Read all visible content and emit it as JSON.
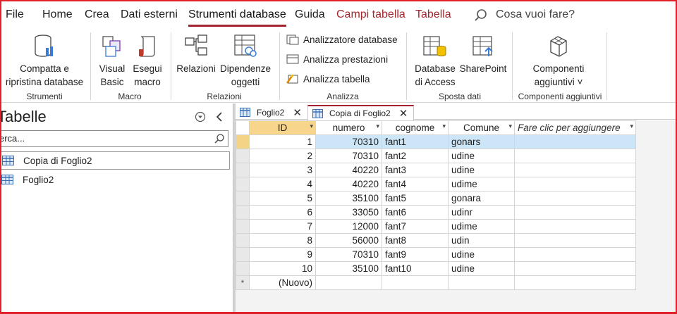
{
  "menu": {
    "items": [
      "File",
      "Home",
      "Crea",
      "Dati esterni",
      "Strumenti database",
      "Guida",
      "Campi tabella",
      "Tabella"
    ],
    "search_placeholder": "Cosa vuoi fare?"
  },
  "ribbon": {
    "compatta_line1": "Compatta e",
    "compatta_line2": "ripristina database",
    "group_strumenti": "Strumenti",
    "visual_line1": "Visual",
    "visual_line2": "Basic",
    "esegui_line1": "Esegui",
    "esegui_line2": "macro",
    "group_macro": "Macro",
    "relazioni": "Relazioni",
    "dipendenze_line1": "Dipendenze",
    "dipendenze_line2": "oggetti",
    "group_relazioni": "Relazioni",
    "analizzatore": "Analizzatore database",
    "analizza_prestazioni": "Analizza prestazioni",
    "analizza_tabella": "Analizza tabella",
    "group_analizza": "Analizza",
    "database_line1": "Database",
    "database_line2": "di Access",
    "sharepoint": "SharePoint",
    "group_sposta": "Sposta dati",
    "componenti_line1": "Componenti",
    "componenti_line2": "aggiuntivi ˅",
    "group_componenti": "Componenti aggiuntivi"
  },
  "nav": {
    "title": "Tabelle",
    "search_value": "erca...",
    "items": [
      "Copia di Foglio2",
      "Foglio2"
    ]
  },
  "tabs": [
    "Foglio2",
    "Copia di Foglio2"
  ],
  "table": {
    "headers": [
      "ID",
      "numero",
      "cognome",
      "Comune",
      "Fare clic per aggiungere"
    ],
    "rows": [
      [
        "1",
        "70310",
        "fant1",
        "gonars"
      ],
      [
        "2",
        "70310",
        "fant2",
        "udine"
      ],
      [
        "3",
        "40220",
        "fant3",
        "udine"
      ],
      [
        "4",
        "40220",
        "fant4",
        "udime"
      ],
      [
        "5",
        "35100",
        "fant5",
        "gonara"
      ],
      [
        "6",
        "33050",
        "fant6",
        "udinr"
      ],
      [
        "7",
        "12000",
        "fant7",
        "udime"
      ],
      [
        "8",
        "56000",
        "fant8",
        "udin"
      ],
      [
        "9",
        "70310",
        "fant9",
        "udine"
      ],
      [
        "10",
        "35100",
        "fant10",
        "udine"
      ]
    ],
    "new_row_marker": "*",
    "new_row_label": "(Nuovo)"
  },
  "colors": {
    "accent": "#a5242f",
    "context_tab": "#a4262c",
    "id_header": "#f7d68b",
    "selected_row": "#cde6f7"
  }
}
